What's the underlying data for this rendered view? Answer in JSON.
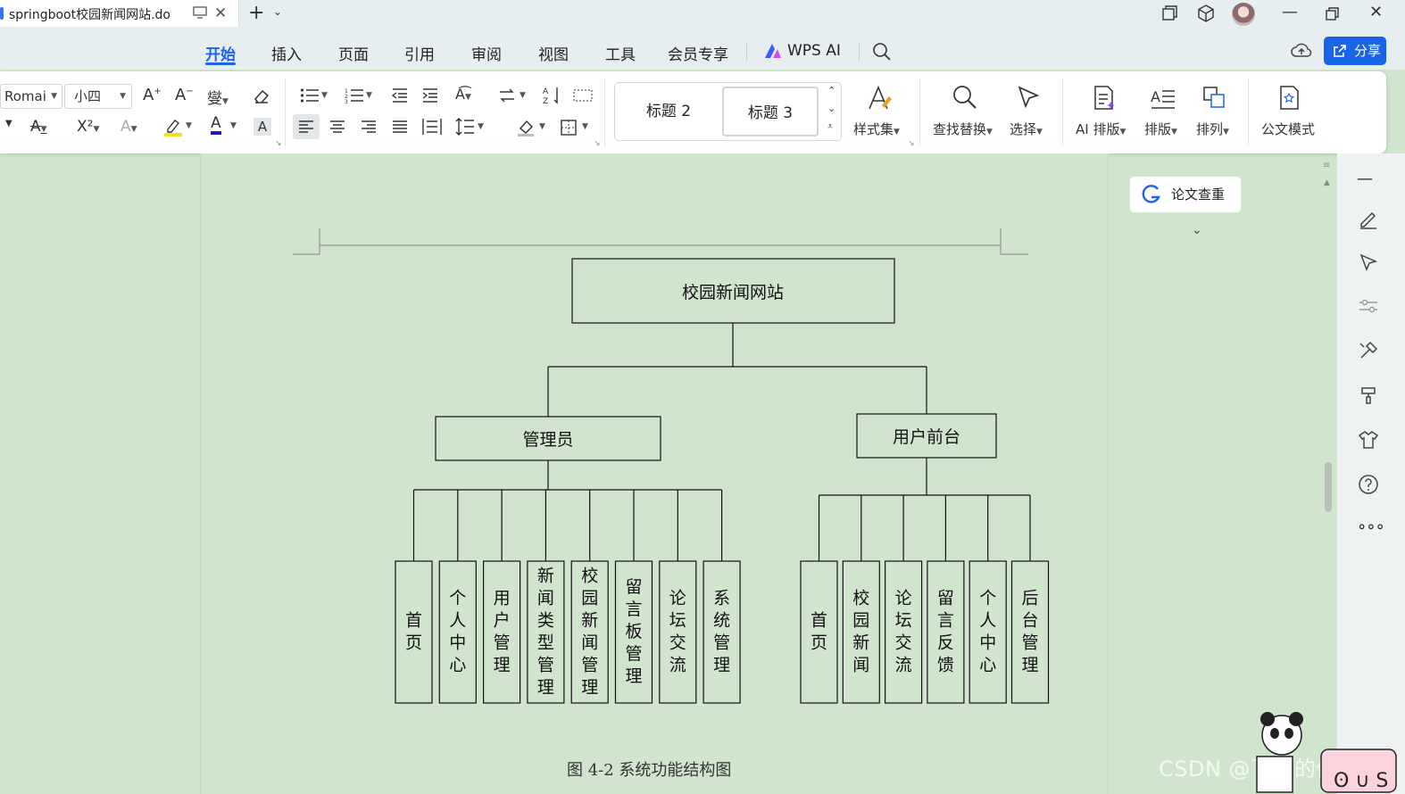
{
  "window": {
    "tab_title": "springboot校园新闻网站.do"
  },
  "menu": {
    "items": [
      "开始",
      "插入",
      "页面",
      "引用",
      "审阅",
      "视图",
      "工具",
      "会员专享"
    ],
    "wps_ai": "WPS AI",
    "share": "分享"
  },
  "ribbon": {
    "font_name": "Romai",
    "font_size": "小四",
    "style_h2": "标题 2",
    "style_h3": "标题 3",
    "styles": "样式集",
    "find_replace": "查找替换",
    "select": "选择",
    "ai_layout": "AI 排版",
    "layout": "排版",
    "arrange": "排列",
    "official_mode": "公文模式"
  },
  "panel": {
    "paper_check": "论文查重"
  },
  "diagram": {
    "root": "校园新闻网站",
    "admin": {
      "label": "管理员",
      "children": [
        "首页",
        "个人中心",
        "用户管理",
        "新闻类型管理",
        "校园新闻管理",
        "留言板管理",
        "论坛交流",
        "系统管理"
      ]
    },
    "user": {
      "label": "用户前台",
      "children": [
        "首页",
        "校园新闻",
        "论坛交流",
        "留言反馈",
        "个人中心",
        "后台管理"
      ]
    },
    "caption": "图 4-2 系统功能结构图"
  },
  "watermark": "CSDN @飞翔的佩奇",
  "colors": {
    "accent": "#1a64e8",
    "page_bg": "#cfe6cd"
  }
}
